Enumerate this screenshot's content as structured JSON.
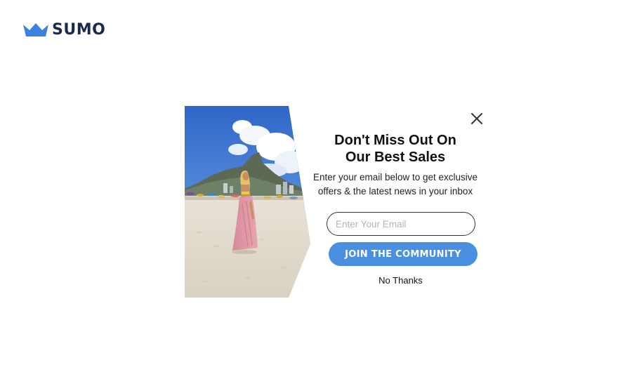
{
  "brand": {
    "logo_icon": "crown-icon",
    "name": "SUMO",
    "crown_color": "#3b82e0",
    "text_color": "#1a2a4f"
  },
  "popup": {
    "image_alt": "beach-photo",
    "close_icon": "close-icon",
    "headline_line1": "Don't Miss Out On",
    "headline_line2": "Our Best Sales",
    "subtext_line1": "Enter your email below to get exclusive",
    "subtext_line2": "offers & the latest news in your inbox",
    "email_placeholder": "Enter Your Email",
    "email_value": "",
    "cta_label": "JOIN THE COMMUNITY",
    "cta_color": "#4a8fe0",
    "decline_label": "No Thanks"
  }
}
